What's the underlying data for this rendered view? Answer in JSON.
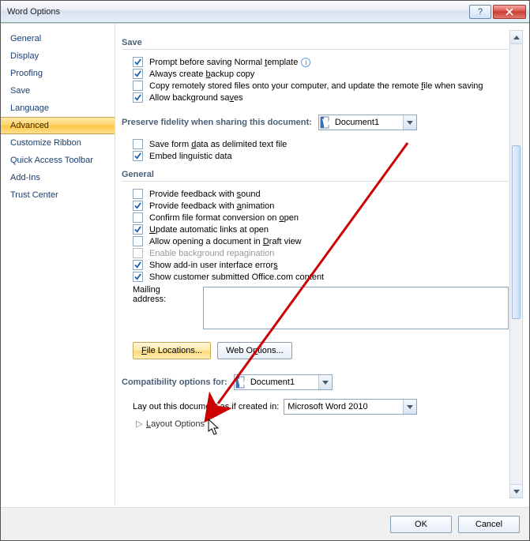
{
  "window": {
    "title": "Word Options"
  },
  "sidebar": {
    "items": [
      {
        "label": "General"
      },
      {
        "label": "Display"
      },
      {
        "label": "Proofing"
      },
      {
        "label": "Save"
      },
      {
        "label": "Language"
      },
      {
        "label": "Advanced"
      },
      {
        "label": "Customize Ribbon"
      },
      {
        "label": "Quick Access Toolbar"
      },
      {
        "label": "Add-Ins"
      },
      {
        "label": "Trust Center"
      }
    ],
    "active_index": 5
  },
  "sections": {
    "save": {
      "header": "Save",
      "opts": [
        {
          "checked": true,
          "pre": "Prompt before saving Normal ",
          "u": "t",
          "post": "emplate",
          "info": true
        },
        {
          "checked": true,
          "pre": "Always create ",
          "u": "b",
          "post": "ackup copy"
        },
        {
          "checked": false,
          "pre": "Copy remotely stored files onto your computer, and update the remote ",
          "u": "f",
          "post": "ile when saving"
        },
        {
          "checked": true,
          "pre": "Allow background sa",
          "u": "v",
          "post": "es"
        }
      ]
    },
    "preserve": {
      "header": "Preserve fidelity when sharing this document:",
      "doc": "Document1",
      "opts": [
        {
          "checked": false,
          "pre": "Save form ",
          "u": "d",
          "post": "ata as delimited text file"
        },
        {
          "checked": true,
          "pre": "Embed lin",
          "u": "g",
          "post": "uistic data"
        }
      ]
    },
    "general": {
      "header": "General",
      "opts": [
        {
          "checked": false,
          "pre": "Provide feedback with ",
          "u": "s",
          "post": "ound"
        },
        {
          "checked": true,
          "pre": "Provide feedback with ",
          "u": "a",
          "post": "nimation"
        },
        {
          "checked": false,
          "pre": "Confirm file format conversion on ",
          "u": "o",
          "post": "pen"
        },
        {
          "checked": true,
          "pre": "",
          "u": "U",
          "post": "pdate automatic links at open"
        },
        {
          "checked": false,
          "pre": "Allow opening a document in ",
          "u": "D",
          "post": "raft view"
        },
        {
          "checked": false,
          "disabled": true,
          "pre": "Enable background repagination",
          "u": "",
          "post": ""
        },
        {
          "checked": true,
          "pre": "Show add-in user interface error",
          "u": "s",
          "post": ""
        },
        {
          "checked": true,
          "pre": "Show customer submitted Office.com content",
          "u": "",
          "post": ""
        }
      ],
      "mailing_label": "Mailing address:",
      "mailing_value": "",
      "file_locations_btn": "File Locations...",
      "web_options_btn": "Web Options..."
    },
    "compat": {
      "header": "Compatibility options for:",
      "doc": "Document1",
      "layout_label": "Lay out this document as if created in:",
      "layout_value": "Microsoft Word 2010",
      "layout_options": "Layout Options"
    }
  },
  "footer": {
    "ok": "OK",
    "cancel": "Cancel"
  }
}
